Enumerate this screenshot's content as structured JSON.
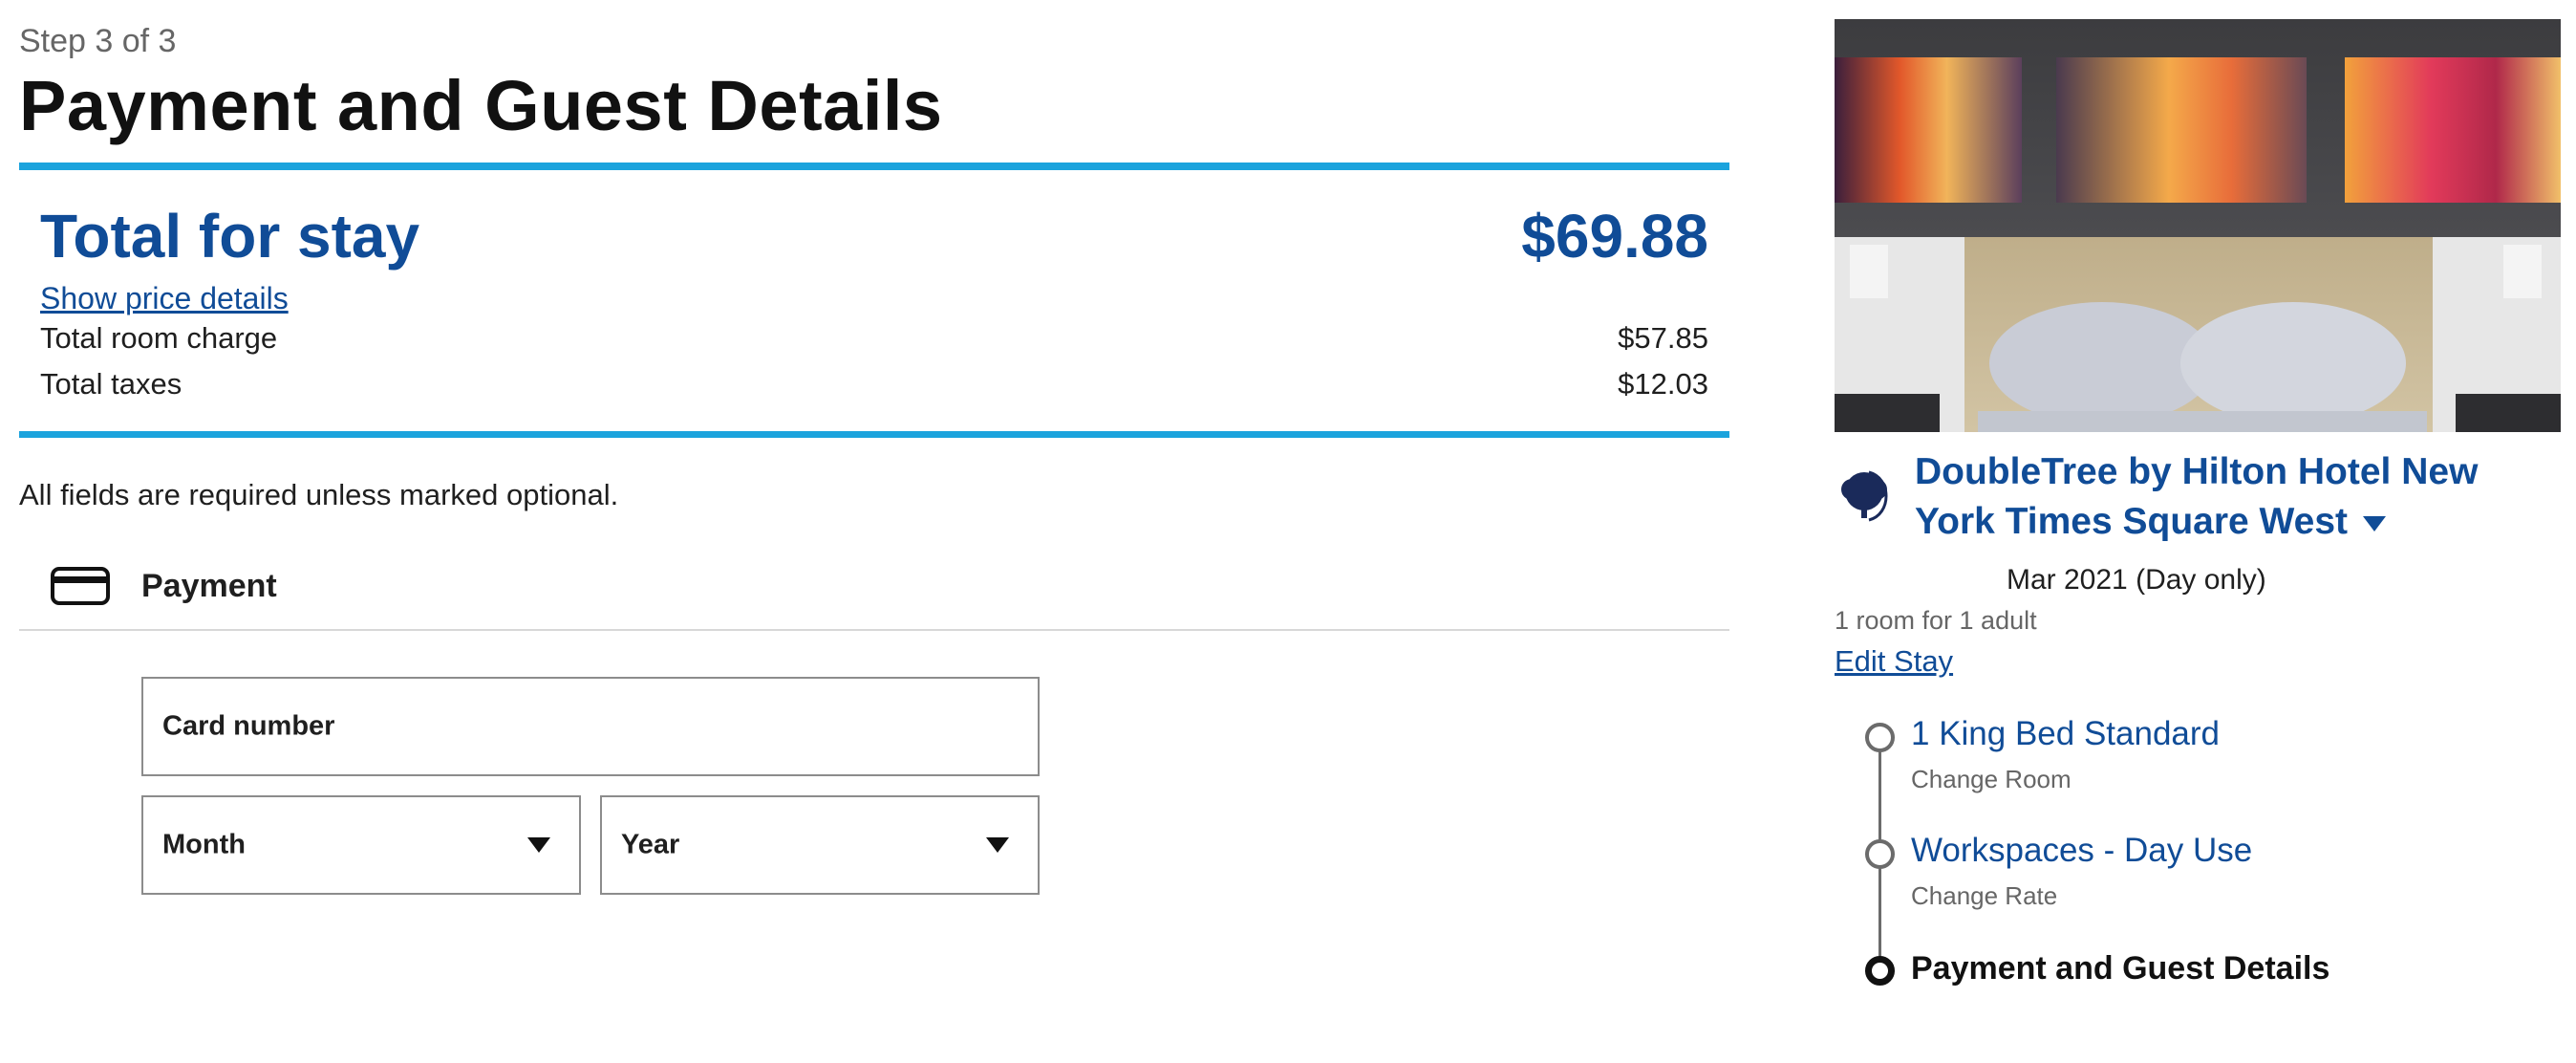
{
  "header": {
    "step": "Step 3 of 3",
    "title": "Payment and Guest Details"
  },
  "price_summary": {
    "total_label": "Total for stay",
    "total_value": "$69.88",
    "details_link": "Show price details",
    "rows": [
      {
        "label": "Total room charge",
        "value": "$57.85"
      },
      {
        "label": "Total taxes",
        "value": "$12.03"
      }
    ]
  },
  "form": {
    "required_note": "All fields are required unless marked optional.",
    "payment_section": {
      "icon": "credit-card-icon",
      "label": "Payment",
      "card_number_label": "Card number",
      "month_label": "Month",
      "year_label": "Year"
    }
  },
  "stay": {
    "brand_icon": "doubletree-tree-icon",
    "hotel_name": "DoubleTree by Hilton Hotel New York Times Square West",
    "dates": "Mar 2021 (Day only)",
    "room_info": "1 room for 1 adult",
    "edit_link": "Edit Stay",
    "steps": [
      {
        "title": "1 King Bed Standard",
        "sub": "Change Room"
      },
      {
        "title": "Workspaces - Day Use",
        "sub": "Change Rate"
      },
      {
        "title": "Payment and Guest Details",
        "sub": ""
      }
    ]
  },
  "colors": {
    "brand_blue": "#104c97",
    "accent_cyan": "#1ba3dd"
  }
}
